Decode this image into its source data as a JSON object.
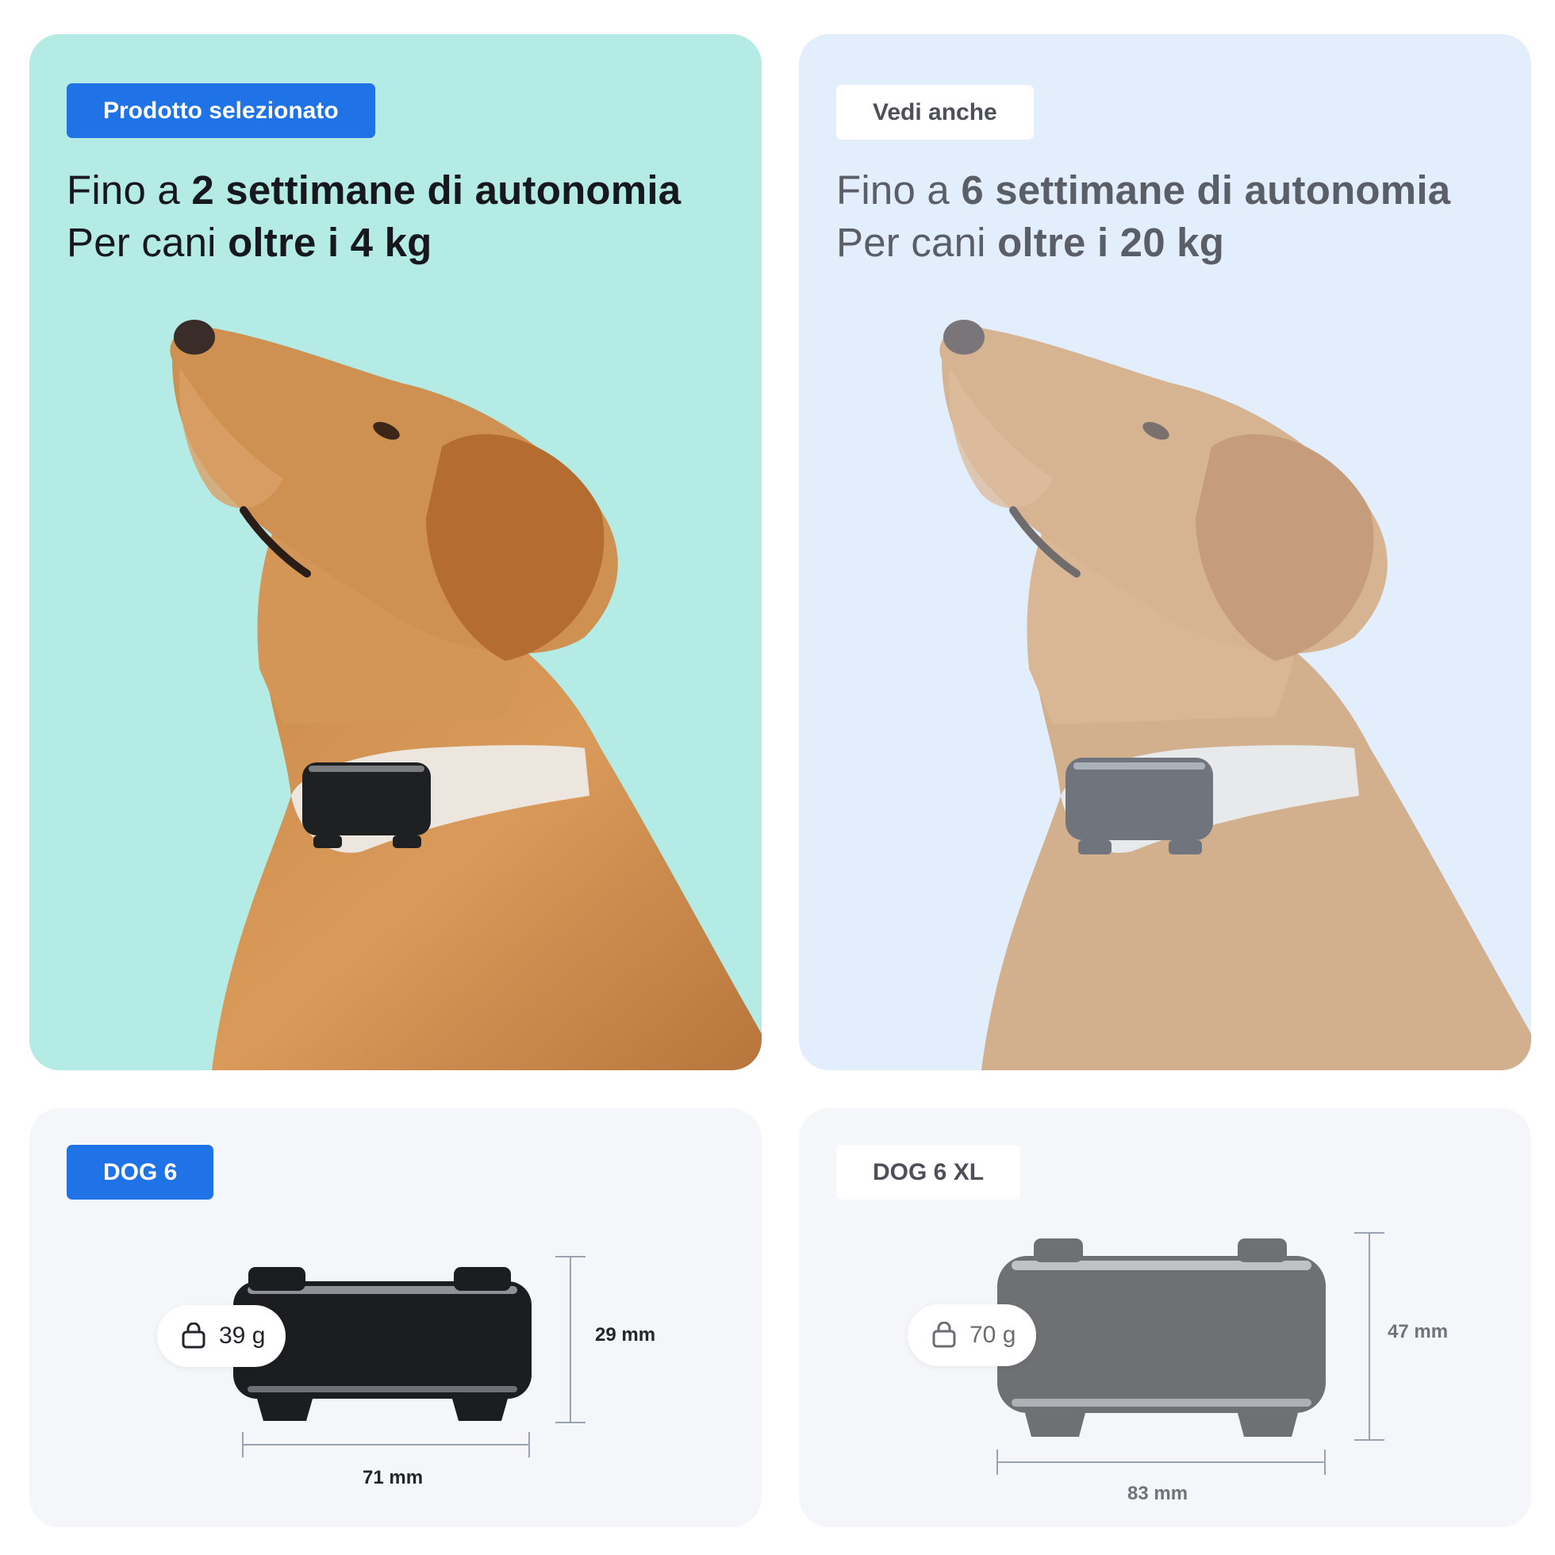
{
  "selected_card": {
    "badge": "Prodotto selezionato",
    "headline": {
      "l1_pre": "Fino a ",
      "l1_bold": "2 settimane di autonomia",
      "l2_pre": "Per cani ",
      "l2_bold": "oltre i 4 kg"
    },
    "background": "#b5ebe5",
    "accent": "#1f73e6"
  },
  "related_card": {
    "badge": "Vedi anche",
    "headline": {
      "l1_pre": "Fino a ",
      "l1_bold": "6 settimane di autonomia",
      "l2_pre": "Per cani ",
      "l2_bold": "oltre i 20 kg"
    },
    "background": "#e3eefd"
  },
  "spec_selected": {
    "name": "DOG 6",
    "weight": "39 g",
    "height": "29 mm",
    "width": "71 mm",
    "weight_icon": "shopping-bag-icon"
  },
  "spec_related": {
    "name": "DOG 6 XL",
    "weight": "70 g",
    "height": "47 mm",
    "width": "83 mm",
    "weight_icon": "shopping-bag-icon"
  }
}
